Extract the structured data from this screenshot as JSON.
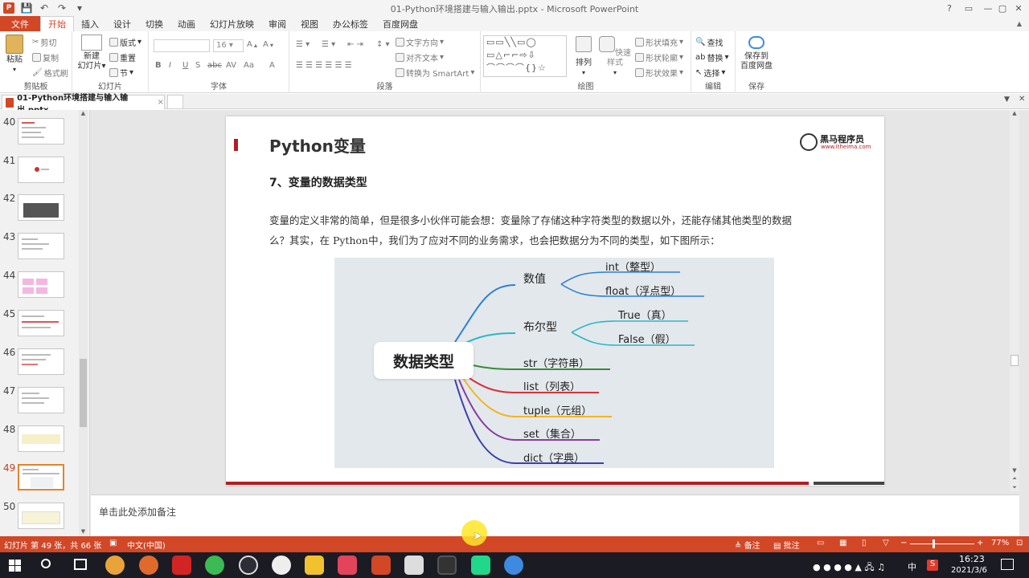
{
  "window": {
    "title": "01-Python环境搭建与输入输出.pptx - Microsoft PowerPoint",
    "help": "?",
    "minimize": "—",
    "restore": "▢",
    "close": "✕",
    "collapse_ribbon": "▲"
  },
  "quick_access": [
    "P",
    "💾",
    "↶",
    "↷",
    "▾"
  ],
  "ribbon_tabs": [
    "文件",
    "开始",
    "插入",
    "设计",
    "切换",
    "动画",
    "幻灯片放映",
    "审阅",
    "视图",
    "办公标签",
    "百度网盘"
  ],
  "ribbon": {
    "clipboard": {
      "label": "剪贴板",
      "paste": "粘贴",
      "cut": "剪切",
      "copy": "复制",
      "format_painter": "格式刷"
    },
    "slides": {
      "label": "幻灯片",
      "new_slide_1": "新建",
      "new_slide_2": "幻灯片",
      "layout": "版式",
      "reset": "重置",
      "section": "节"
    },
    "font": {
      "label": "字体",
      "size": "16",
      "bold": "B",
      "italic": "I",
      "underline": "U",
      "shadow": "S",
      "strike": "abc",
      "spacing": "AV",
      "case": "Aa",
      "color": "A"
    },
    "paragraph": {
      "label": "段落",
      "text_direction": "文字方向",
      "align_text": "对齐文本",
      "smartart": "转换为 SmartArt"
    },
    "drawing": {
      "label": "绘图",
      "arrange": "排列",
      "quick_styles": "快速样式",
      "shape_fill": "形状填充",
      "shape_outline": "形状轮廓",
      "shape_effects": "形状效果"
    },
    "editing": {
      "label": "编辑",
      "find": "查找",
      "replace": "替换",
      "select": "选择"
    },
    "save": {
      "label": "保存",
      "btn_1": "保存到",
      "btn_2": "百度网盘"
    }
  },
  "doc_tab": {
    "name": "01-Python环境搭建与输入输出.pptx",
    "close": "×"
  },
  "thumbnails": [
    {
      "num": "40"
    },
    {
      "num": "41"
    },
    {
      "num": "42"
    },
    {
      "num": "43"
    },
    {
      "num": "44"
    },
    {
      "num": "45"
    },
    {
      "num": "46"
    },
    {
      "num": "47"
    },
    {
      "num": "48"
    },
    {
      "num": "49"
    },
    {
      "num": "50"
    }
  ],
  "slide": {
    "title": "Python变量",
    "logo_text": "黑马程序员",
    "logo_url": "www.itheima.com",
    "subtitle": "7、变量的数据类型",
    "body_line1": "变量的定义非常的简单，但是很多小伙伴可能会想：变量除了存储这种字符类型的数据以外，还能存储其他类型的数据",
    "body_line2": "么？其实，在 Python中，我们为了应对不同的业务需求，也会把数据分为不同的类型，如下图所示：",
    "mindmap": {
      "root": "数据类型",
      "number": "数值",
      "int": "int（整型）",
      "float": "float（浮点型）",
      "bool": "布尔型",
      "true": "True（真）",
      "false": "False（假）",
      "str": "str（字符串）",
      "list": "list（列表）",
      "tuple": "tuple（元组）",
      "set": "set（集合）",
      "dict": "dict（字典）"
    }
  },
  "notes_placeholder": "单击此处添加备注",
  "status": {
    "slide_info": "幻灯片 第 49 张，共 66 张",
    "language": "中文(中国)",
    "notes": "备注",
    "comments": "批注",
    "zoom": "77%"
  },
  "tray": {
    "time": "16:23",
    "date": "2021/3/6",
    "ime": "中",
    "ime_s": "S"
  }
}
